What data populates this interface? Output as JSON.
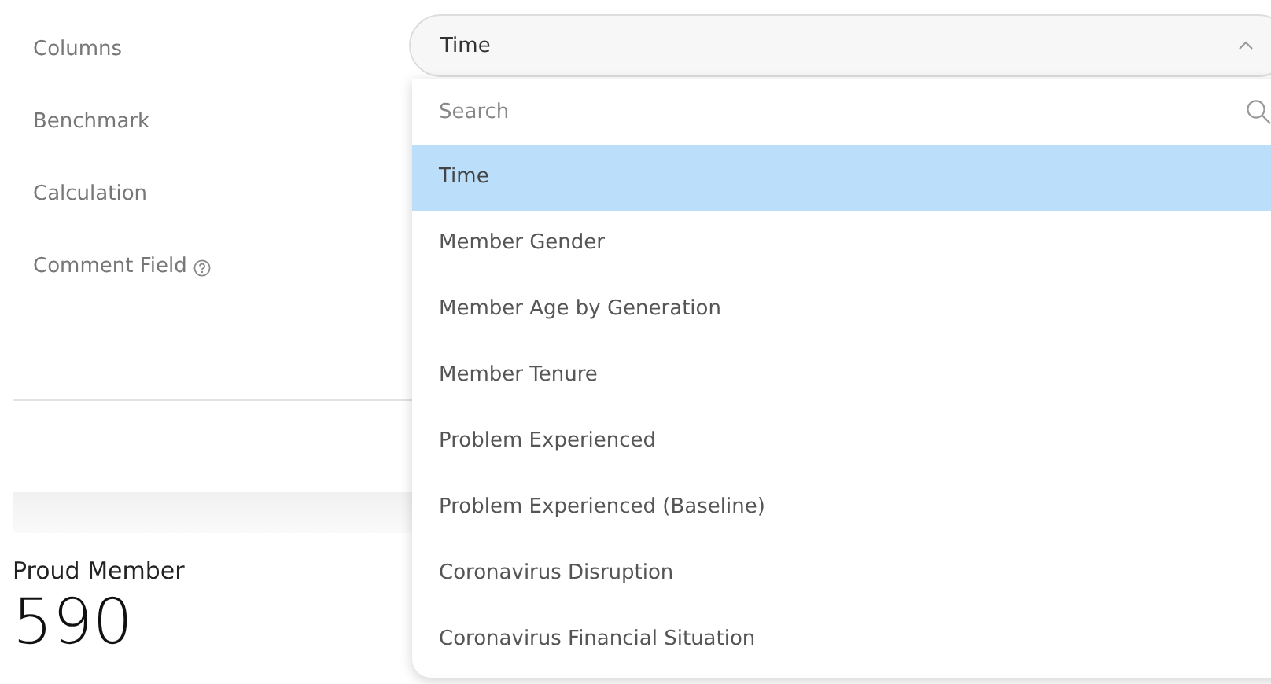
{
  "form": {
    "fields": [
      {
        "label": "Columns",
        "help": false
      },
      {
        "label": "Benchmark",
        "help": false
      },
      {
        "label": "Calculation",
        "help": false
      },
      {
        "label": "Comment Field",
        "help": true
      }
    ]
  },
  "select": {
    "value": "Time",
    "expanded": true
  },
  "dropdown": {
    "search": {
      "placeholder": "Search"
    },
    "options": [
      {
        "label": "Time",
        "selected": true
      },
      {
        "label": "Member Gender",
        "selected": false
      },
      {
        "label": "Member Age by Generation",
        "selected": false
      },
      {
        "label": "Member Tenure",
        "selected": false
      },
      {
        "label": "Problem Experienced",
        "selected": false
      },
      {
        "label": "Problem Experienced (Baseline)",
        "selected": false
      },
      {
        "label": "Coronavirus Disruption",
        "selected": false
      },
      {
        "label": "Coronavirus Financial Situation",
        "selected": false
      }
    ]
  },
  "card": {
    "title": "Proud Member",
    "value": "590"
  }
}
